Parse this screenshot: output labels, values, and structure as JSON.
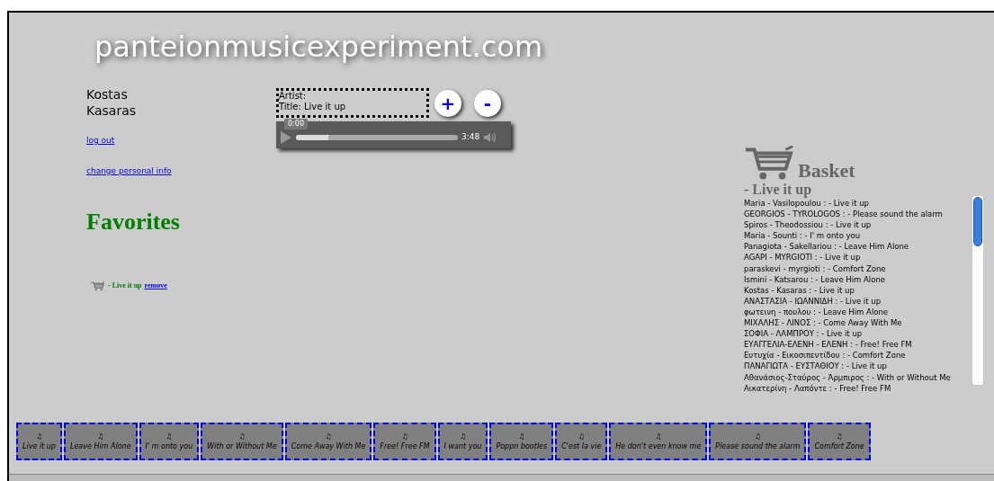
{
  "site_title": "panteionmusicexperiment.com",
  "user": {
    "first_name": "Kostas",
    "last_name": "Kasaras"
  },
  "links": [
    "log out",
    "change personal info"
  ],
  "now_playing": {
    "artist_label": "Artist:",
    "title_label": "Title: Live it up",
    "add": "+",
    "remove": "-"
  },
  "player": {
    "time_tooltip": "0:00",
    "duration": "3:48",
    "level": 0.2
  },
  "favorites": {
    "heading": "Favorites",
    "items": [
      {
        "title": "- Live it up",
        "action": "remove"
      }
    ]
  },
  "basket": {
    "heading": "Basket",
    "current": "- Live it up",
    "entries": [
      "Maria - Vasilopoulou : - Live it up",
      "GEORGIOS - TYROLOGOS : - Please sound the alarm",
      "Spiros - Theodossiou : - Live it up",
      "Maria - Sounti : - I' m onto you",
      "Panagiota - Sakellariou : - Leave Him Alone",
      "AGAPI - MYRGIOTI : - Live it up",
      "paraskevi - myrgioti : - Comfort Zone",
      "Ismini - Katsarou : - Leave Him Alone",
      "Kostas - Kasaras : - Live it up",
      "ΑΝΑΣΤΑΣΙΑ - ΙΩΑΝΝΙΔΗ : - Live it up",
      "φωτεινη - πουλου : - Leave Him Alone",
      "ΜΙΧΑΛΗΣ - ΛΙΝΟΣ : - Come Away With Me",
      "ΣΟΦΙΑ - ΛΑΜΠΡΟΥ : - Live it up",
      "ΕΥΑΓΓΕΛΙΑ-ΕΛΕΝΗ - ΕΛΕΝΗ : - Free! Free FM",
      "Ευτυχία - Εικοσιπεντίδου : - Comfort Zone",
      "ΠΑΝΑΓΙΩΤΑ - ΕΥΣΤΑΘΙΟΥ : - Live it up",
      "Αθανάσιος-Σταύρος - Άρμπιρος : - With or Without Me",
      "Αικατερίνη - Λαπόντε : - Free! Free FM"
    ]
  },
  "tracks": [
    {
      "icon": "♫",
      "title": "Live it up"
    },
    {
      "icon": "♫",
      "title": "Leave Him Alone"
    },
    {
      "icon": "♫",
      "title": "I' m onto you"
    },
    {
      "icon": "♫",
      "title": "With or Without Me"
    },
    {
      "icon": "♫",
      "title": "Come Away With Me"
    },
    {
      "icon": "♫",
      "title": "Free! Free FM"
    },
    {
      "icon": "♫",
      "title": "I want you"
    },
    {
      "icon": "♫",
      "title": "Poppn bootles"
    },
    {
      "icon": "♫",
      "title": "C'est la vie"
    },
    {
      "icon": "♫",
      "title": "He don't even know me"
    },
    {
      "icon": "♫",
      "title": "Please sound the alarm"
    },
    {
      "icon": "♫",
      "title": "Comfort Zone"
    }
  ]
}
